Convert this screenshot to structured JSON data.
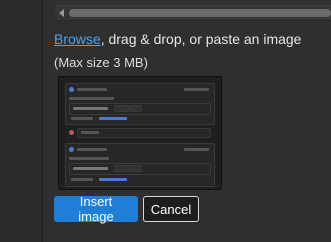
{
  "upload": {
    "browse_link": "Browse",
    "rest_text": ", drag & drop, or paste an image",
    "max_size": "(Max size 3 MB)"
  },
  "preview": {
    "items": [
      {
        "author": "User Username",
        "badge": "•",
        "meta": "Sep 00 2024, 00:00 AM",
        "body": "Post your Bee 3 Pride",
        "prompt": "Was this answer helpful?"
      },
      {
        "author": "User Username",
        "badge": "•",
        "meta": "Sep 00 2024, 00:00 AM",
        "body": "Show info for the docs",
        "prompt": "Was this answer helpful?"
      }
    ]
  },
  "actions": {
    "insert_label": "Insert image",
    "cancel_label": "Cancel"
  },
  "colors": {
    "link": "#4aa3ef",
    "primary": "#1f7fd6"
  }
}
